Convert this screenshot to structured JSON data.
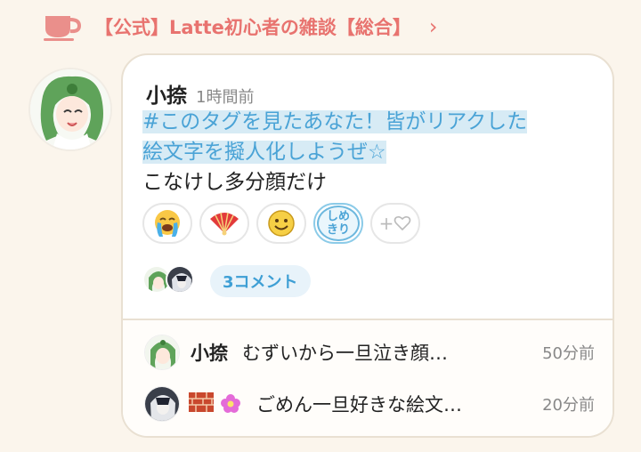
{
  "channel": {
    "title": "【公式】Latte初心者の雑談【総合】",
    "chevron": "›",
    "icon": "coffee-cup-icon"
  },
  "post": {
    "author": "小捺",
    "time": "1時間前",
    "hashtag_line1": "#このタグを見たあなた！皆がリアクした",
    "hashtag_line2": "絵文字を擬人化しようぜ☆",
    "text": "こなけし多分顔だけ",
    "reactions": [
      {
        "icon": "crying-face-emoji",
        "glyph": "😭"
      },
      {
        "icon": "folding-fan-emoji",
        "glyph": "🪭"
      },
      {
        "icon": "smiley-face-emoji",
        "glyph": "🙂"
      },
      {
        "icon": "shimekiri-stamp",
        "line1": "しめ",
        "line2": "きり"
      }
    ],
    "add_reaction": "+",
    "comment_count": "3コメント"
  },
  "comments": [
    {
      "author": "小捺",
      "text": "むずいから一旦泣き顔…",
      "time": "50分前"
    },
    {
      "author": "",
      "text": "ごめん一旦好きな絵文…",
      "time": "20分前",
      "icons": [
        "brick-emoji",
        "flower-emoji"
      ]
    }
  ],
  "colors": {
    "accent": "#e8736f",
    "link_blue": "#4aa3d6",
    "background": "#fbf5ec"
  }
}
